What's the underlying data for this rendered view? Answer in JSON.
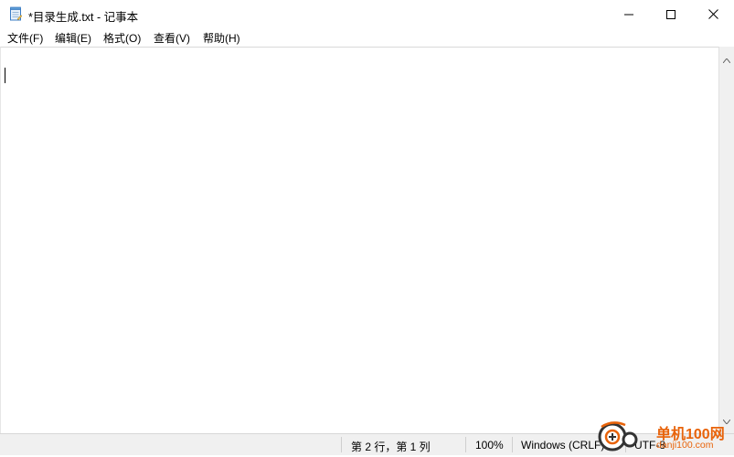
{
  "window": {
    "title": "*目录生成.txt - 记事本"
  },
  "caption": {
    "minimize_icon": "minimize-icon",
    "maximize_icon": "maximize-icon",
    "close_icon": "close-icon"
  },
  "menu": {
    "items": [
      {
        "label": "文件(F)"
      },
      {
        "label": "编辑(E)"
      },
      {
        "label": "格式(O)"
      },
      {
        "label": "查看(V)"
      },
      {
        "label": "帮助(H)"
      }
    ]
  },
  "editor": {
    "content": ""
  },
  "status": {
    "position": "第 2 行，第 1 列",
    "zoom": "100%",
    "line_ending": "Windows (CRLF)",
    "encoding": "UTF-8"
  },
  "watermark": {
    "brand": "单机100网",
    "url": "danji100.com",
    "color": "#e8630a"
  }
}
